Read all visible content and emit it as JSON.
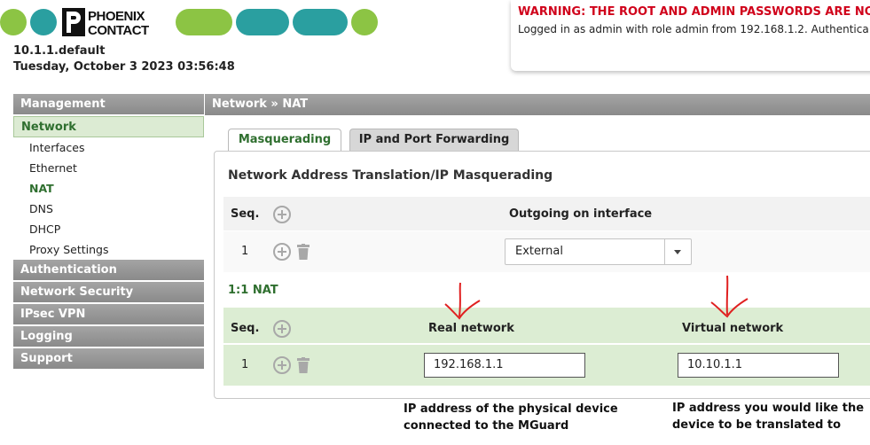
{
  "header": {
    "brand_name": "PHOENIX CONTACT",
    "brand_colors": {
      "teal": "#2a9fa0",
      "green": "#8cc444"
    },
    "hostname": "10.1.1.default",
    "datetime": "Tuesday, October 3 2023 03:56:48",
    "warning": "WARNING: THE ROOT AND ADMIN PASSWORDS ARE NOT C",
    "login_info": "Logged in as admin with role admin from 192.168.1.2. Authentica"
  },
  "sidebar": {
    "management": "Management",
    "network": "Network",
    "network_items": [
      "Interfaces",
      "Ethernet",
      "NAT",
      "DNS",
      "DHCP",
      "Proxy Settings"
    ],
    "authentication": "Authentication",
    "network_security": "Network Security",
    "ipsec_vpn": "IPsec VPN",
    "logging": "Logging",
    "support": "Support"
  },
  "breadcrumb": "Network  »  NAT",
  "tabs": {
    "masquerading": "Masquerading",
    "port_forwarding": "IP and Port Forwarding"
  },
  "masquerading": {
    "title": "Network Address Translation/IP Masquerading",
    "col_seq": "Seq.",
    "col_outgoing": "Outgoing on interface",
    "row_seq": "1",
    "interface_value": "External"
  },
  "one_to_one": {
    "title": "1:1 NAT",
    "col_seq": "Seq.",
    "col_real": "Real network",
    "col_virtual": "Virtual network",
    "row_seq": "1",
    "real_value": "192.168.1.1",
    "virtual_value": "10.10.1.1"
  },
  "annotations": {
    "real_note_line1": "IP address of the physical device",
    "real_note_line2": "connected to the MGuard",
    "virtual_note_line1": "IP address you would like the",
    "virtual_note_line2": "device to be translated to",
    "arrow_color": "#e02020"
  }
}
